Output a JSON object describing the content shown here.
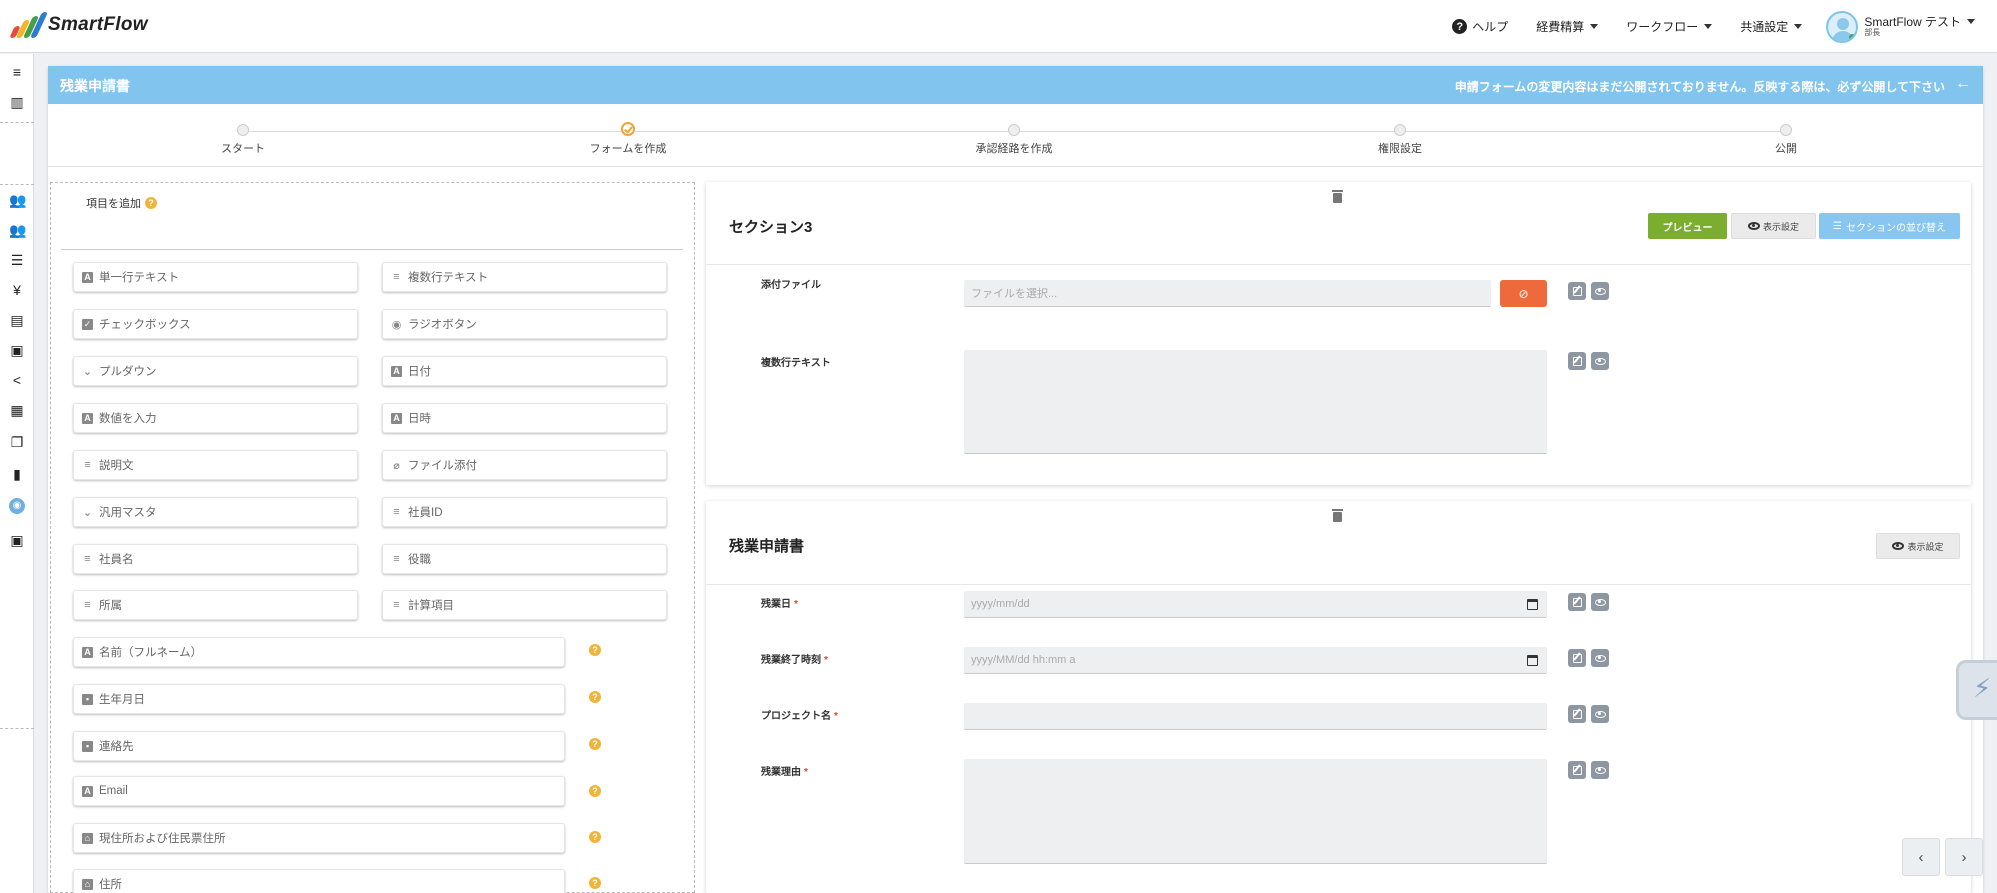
{
  "brand": {
    "name": "SmartFlow",
    "colors": [
      "#e84b3c",
      "#f5b427",
      "#43a047",
      "#2e7bd6"
    ]
  },
  "topnav": {
    "help": "ヘルプ",
    "expense": "経費精算",
    "workflow": "ワークフロー",
    "common": "共通設定",
    "user_name": "SmartFlow テスト",
    "user_dept": "部長"
  },
  "sidebar": {
    "icons": [
      "collapse-icon",
      "company-icon",
      "users-icon",
      "group-icon",
      "list-icon",
      "yen-icon",
      "document-icon",
      "form-icon",
      "share-icon",
      "table-icon",
      "copy-icon",
      "file-icon",
      "palette-icon",
      "wallet-icon"
    ]
  },
  "titlebar": {
    "title": "残業申請書",
    "notice": "申請フォームの変更内容はまだ公開されておりません。反映する際は、必ず公開して下さい",
    "color": "#81c4ee"
  },
  "stepper": {
    "steps": [
      "スタート",
      "フォームを作成",
      "承認経路を作成",
      "権限設定",
      "公開"
    ],
    "active_index": 1,
    "active_color": "#f0a537"
  },
  "palette": {
    "header": "項目を追加",
    "grid_items": [
      {
        "label": "単一行テキスト",
        "icon": "text-icon"
      },
      {
        "label": "複数行テキスト",
        "icon": "multiline-icon"
      },
      {
        "label": "チェックボックス",
        "icon": "checkbox-icon"
      },
      {
        "label": "ラジオボタン",
        "icon": "radio-icon"
      },
      {
        "label": "プルダウン",
        "icon": "chevron-down-icon"
      },
      {
        "label": "日付",
        "icon": "date-icon"
      },
      {
        "label": "数値を入力",
        "icon": "number-icon"
      },
      {
        "label": "日時",
        "icon": "datetime-icon"
      },
      {
        "label": "説明文",
        "icon": "description-icon"
      },
      {
        "label": "ファイル添付",
        "icon": "paperclip-icon"
      },
      {
        "label": "汎用マスタ",
        "icon": "chevron-down-icon"
      },
      {
        "label": "社員ID",
        "icon": "employee-id-icon"
      },
      {
        "label": "社員名",
        "icon": "employee-name-icon"
      },
      {
        "label": "役職",
        "icon": "position-icon"
      },
      {
        "label": "所属",
        "icon": "department-icon"
      },
      {
        "label": "計算項目",
        "icon": "calc-icon"
      }
    ],
    "wide_items": [
      {
        "label": "名前（フルネーム）",
        "icon": "text-icon"
      },
      {
        "label": "生年月日",
        "icon": "calendar-icon"
      },
      {
        "label": "連絡先",
        "icon": "contact-icon"
      },
      {
        "label": "Email",
        "icon": "text-icon"
      },
      {
        "label": "現住所および住民票住所",
        "icon": "home-icon"
      },
      {
        "label": "住所",
        "icon": "home-icon"
      }
    ]
  },
  "section3": {
    "title": "セクション3",
    "preview_label": "プレビュー",
    "display_label": "表示設定",
    "reorder_label": "セクションの並び替え",
    "fields": [
      {
        "label": "添付ファイル",
        "placeholder": "ファイルを選択..."
      },
      {
        "label": "複数行テキスト",
        "placeholder": ""
      }
    ]
  },
  "section_main": {
    "title": "残業申請書",
    "display_label": "表示設定",
    "fields": [
      {
        "label": "残業日",
        "placeholder": "yyyy/mm/dd",
        "required": "*"
      },
      {
        "label": "残業終了時刻",
        "placeholder": "yyyy/MM/dd hh:mm a",
        "required": "*"
      },
      {
        "label": "プロジェクト名",
        "placeholder": "",
        "required": "*"
      },
      {
        "label": "残業理由",
        "placeholder": "",
        "required": "*"
      }
    ]
  },
  "pager": {
    "prev": "‹",
    "next": "›"
  }
}
